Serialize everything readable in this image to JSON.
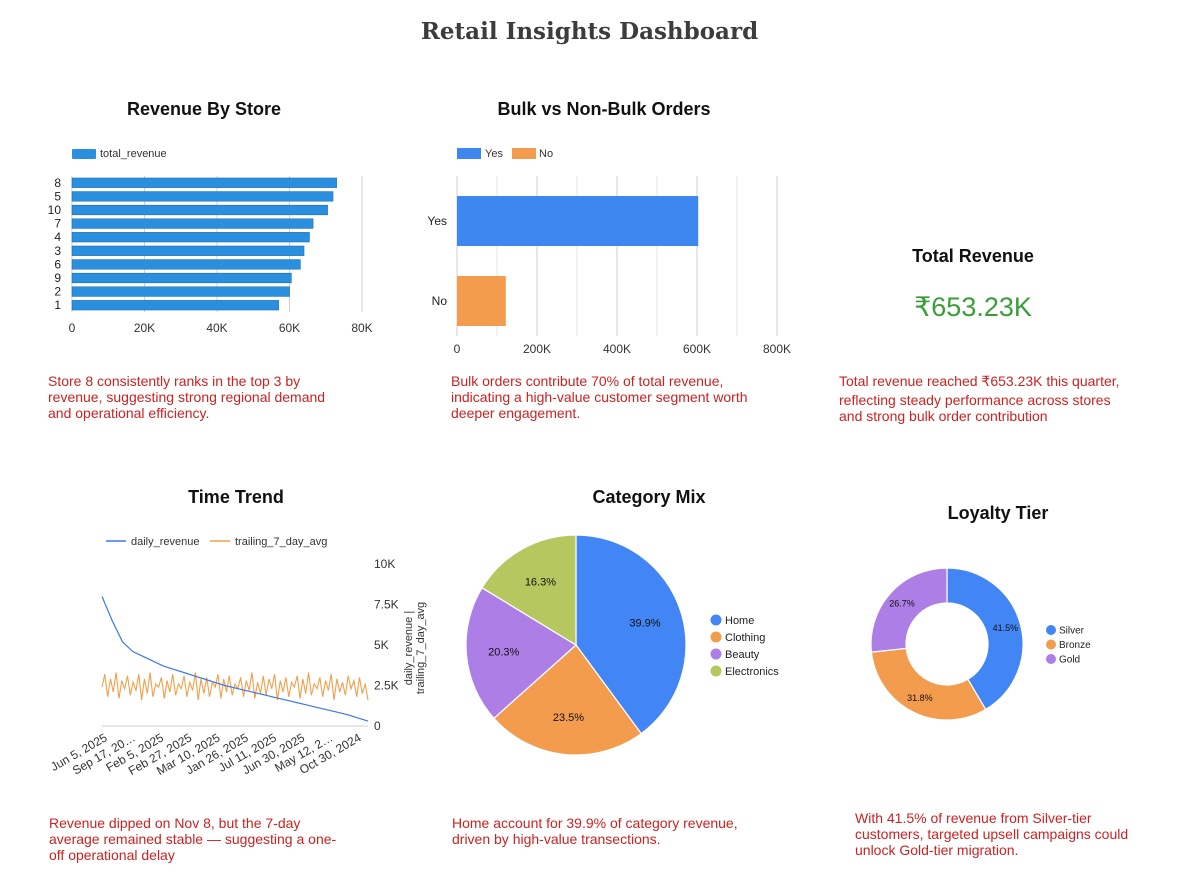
{
  "dashboard": {
    "title": "Retail Insights Dashboard"
  },
  "colors": {
    "blue": "#2b8fdf",
    "bulk_yes": "#3f87f0",
    "bulk_no": "#f39c4e",
    "insight_red": "#cc2222",
    "kpi_green": "#3a9d3a",
    "pie_home": "#4285f4",
    "pie_clothing": "#f39c4e",
    "pie_beauty": "#ac7ee6",
    "pie_electronics": "#b5c75e",
    "line_daily": "#3b78e7",
    "line_trailing": "#f0a04b"
  },
  "panels": {
    "revenue_by_store": {
      "title": "Revenue By Store",
      "insight": [
        "Store 8 consistently ranks in the top 3 by",
        "revenue, suggesting strong regional demand",
        "and operational efficiency."
      ]
    },
    "bulk_orders": {
      "title": "Bulk vs Non-Bulk Orders",
      "insight": [
        "Bulk orders contribute 70% of total revenue,",
        "indicating a high-value customer segment worth",
        "deeper engagement."
      ]
    },
    "total_revenue": {
      "label": "Total Revenue",
      "value": "₹653.23K",
      "insight": [
        "Total revenue reached ₹653.23K this quarter,",
        "reflecting steady performance across stores",
        "and strong bulk order contribution"
      ]
    },
    "time_trend": {
      "title": "Time Trend",
      "insight": [
        "Revenue dipped on Nov 8, but the 7-day",
        "average remained stable — suggesting a one-",
        "off operational delay"
      ]
    },
    "category_mix": {
      "title": "Category Mix",
      "insight": [
        "Home  account for 39.9% of category revenue,",
        "driven by high-value transections."
      ]
    },
    "loyalty_tier": {
      "title": "Loyalty Tier",
      "insight": [
        "With 41.5% of revenue from Silver-tier",
        "customers, targeted upsell campaigns could",
        "unlock Gold-tier migration."
      ]
    }
  },
  "chart_data": [
    {
      "id": "revenue_by_store",
      "type": "bar",
      "orientation": "horizontal",
      "categories": [
        "8",
        "5",
        "10",
        "7",
        "4",
        "3",
        "6",
        "9",
        "2",
        "1"
      ],
      "series": [
        {
          "name": "total_revenue",
          "values": [
            73000,
            72000,
            70500,
            66500,
            65500,
            64000,
            63000,
            60500,
            60000,
            57000
          ]
        }
      ],
      "xlim": [
        0,
        80000
      ],
      "ticks": [
        "0",
        "20K",
        "40K",
        "60K",
        "80K"
      ],
      "legend": "top-left"
    },
    {
      "id": "bulk_orders",
      "type": "bar",
      "orientation": "horizontal",
      "categories": [
        "Yes",
        "No"
      ],
      "series": [
        {
          "name": "Yes",
          "values": [
            603000
          ]
        },
        {
          "name": "No",
          "values": [
            122000
          ]
        }
      ],
      "xlim": [
        0,
        800000
      ],
      "ticks": [
        "0",
        "200K",
        "400K",
        "600K",
        "800K"
      ],
      "legend": "top-left"
    },
    {
      "id": "time_trend",
      "type": "line",
      "x_ticks": [
        "Jun 5, 2025",
        "Sep 17, 20…",
        "Feb 5, 2025",
        "Feb 27, 2025",
        "Mar 10, 2025",
        "Jan 26, 2025",
        "Jul 11, 2025",
        "Jun 30, 2025",
        "May 12, 2…",
        "Oct 30, 2024"
      ],
      "ylabel": "daily_revenue | trailing_7_day_avg",
      "ylim": [
        0,
        10000
      ],
      "y_ticks": [
        "0",
        "2.5K",
        "5K",
        "7.5K",
        "10K"
      ],
      "series": [
        {
          "name": "daily_revenue",
          "values": [
            8000,
            6500,
            5200,
            4600,
            4300,
            4000,
            3700,
            3500,
            3300,
            3100,
            2900,
            2700,
            2500,
            2350,
            2200,
            2050,
            1900,
            1750,
            1600,
            1450,
            1300,
            1150,
            1000,
            850,
            700,
            500,
            300
          ]
        },
        {
          "name": "trailing_7_day_avg",
          "values": [
            2400,
            3200,
            1800,
            2900,
            2100,
            3300,
            1700,
            2800,
            2300,
            3100,
            1900,
            2700,
            2200,
            3200,
            1600,
            2900,
            2000,
            3300,
            1800,
            2600,
            2400,
            3000,
            1700,
            2800,
            2100,
            3200,
            1900,
            2600,
            2300,
            3100,
            1800,
            2700,
            2200,
            3300,
            1600,
            2900,
            2000,
            3000,
            1800,
            2700,
            2400,
            3200,
            1700,
            2900,
            2100,
            3100,
            1900,
            2600,
            2300,
            3000,
            1800,
            2800,
            2200,
            3300,
            1700,
            2700,
            2000,
            3100,
            1900,
            2900,
            2300,
            3200,
            1600,
            2800,
            2100,
            3000,
            1800,
            2700,
            2400,
            3100,
            1700,
            2900,
            2000,
            3300,
            1900,
            2600,
            2300,
            3000,
            1800,
            2800,
            2200,
            3200,
            1600,
            2900,
            2100,
            2700,
            1900,
            3100,
            2300,
            2800,
            1800,
            3000,
            2000,
            2600,
            1600
          ]
        }
      ],
      "legend": "top"
    },
    {
      "id": "category_mix",
      "type": "pie",
      "categories": [
        "Home",
        "Clothing",
        "Beauty",
        "Electronics"
      ],
      "values": [
        39.9,
        23.5,
        20.3,
        16.3
      ],
      "labels": [
        "39.9%",
        "23.5%",
        "20.3%",
        "16.3%"
      ],
      "legend": "right"
    },
    {
      "id": "loyalty_tier",
      "type": "pie",
      "donut": true,
      "categories": [
        "Silver",
        "Bronze",
        "Gold"
      ],
      "values": [
        41.5,
        31.8,
        26.7
      ],
      "labels": [
        "41.5%",
        "31.8%",
        "26.7%"
      ],
      "legend": "right"
    }
  ]
}
